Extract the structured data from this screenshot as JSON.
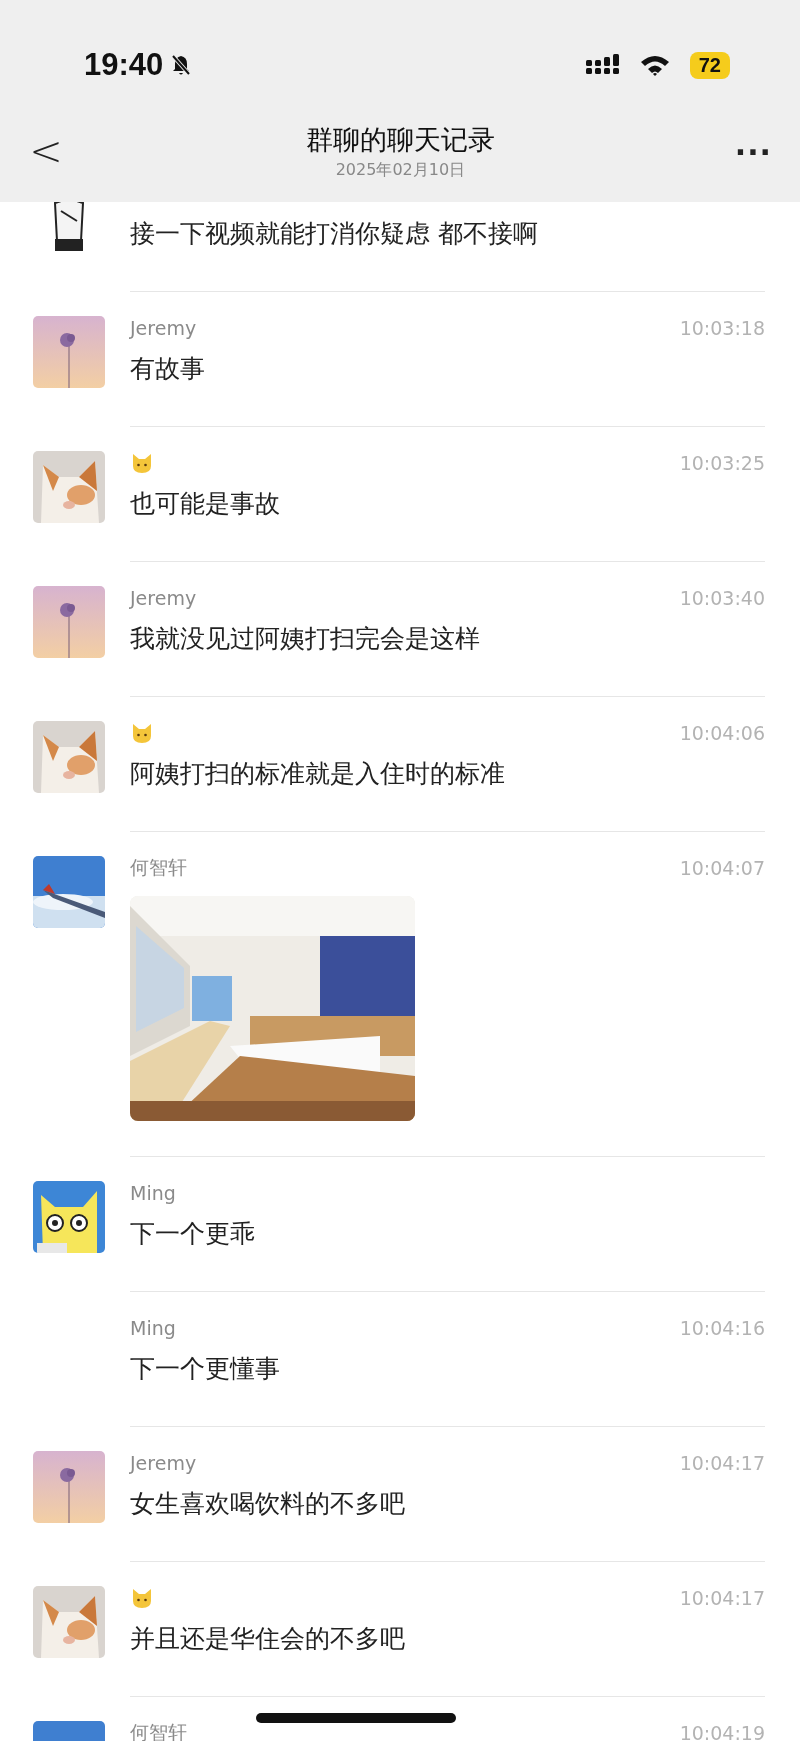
{
  "status_bar": {
    "time": "19:40",
    "battery": "72"
  },
  "header": {
    "back": "<",
    "title": "群聊的聊天记录",
    "subtitle": "2025年02月10日",
    "more": "..."
  },
  "messages": [
    {
      "kind": "text",
      "name_icon": false,
      "text": "接一下视频就能打消你疑虑 都不接啊"
    },
    {
      "kind": "text",
      "avatar": {
        "kind": "flower"
      },
      "name": "Jeremy",
      "name_icon": false,
      "time": "10:03:18",
      "text": "有故事"
    },
    {
      "kind": "text",
      "avatar": {
        "kind": "cat"
      },
      "name_icon": true,
      "time": "10:03:25",
      "text": "也可能是事故"
    },
    {
      "kind": "text",
      "avatar": {
        "kind": "flower"
      },
      "name": "Jeremy",
      "name_icon": false,
      "time": "10:03:40",
      "text": "我就没见过阿姨打扫完会是这样"
    },
    {
      "kind": "text",
      "avatar": {
        "kind": "cat"
      },
      "name_icon": true,
      "time": "10:04:06",
      "text": "阿姨打扫的标准就是入住时的标准"
    },
    {
      "avatar": {
        "kind": "plane"
      },
      "name": "何智轩",
      "name_icon": false,
      "time": "10:04:07"
    },
    {
      "kind": "text",
      "avatar": {
        "kind": "cartoon"
      },
      "name": "Ming",
      "name_icon": false,
      "text": "下一个更乖"
    },
    {
      "kind": "text",
      "name": "Ming",
      "name_icon": false,
      "time": "10:04:16",
      "text": "下一个更懂事"
    },
    {
      "kind": "text",
      "avatar": {
        "kind": "flower"
      },
      "name": "Jeremy",
      "name_icon": false,
      "time": "10:04:17",
      "text": "女生喜欢喝饮料的不多吧"
    },
    {
      "kind": "text",
      "avatar": {
        "kind": "cat"
      },
      "name_icon": true,
      "time": "10:04:17",
      "text": "并且还是华住会的不多吧"
    },
    {
      "kind": "text",
      "avatar": {
        "kind": "plane"
      },
      "name": "何智轩",
      "name_icon": false,
      "time": "10:04:19"
    }
  ]
}
